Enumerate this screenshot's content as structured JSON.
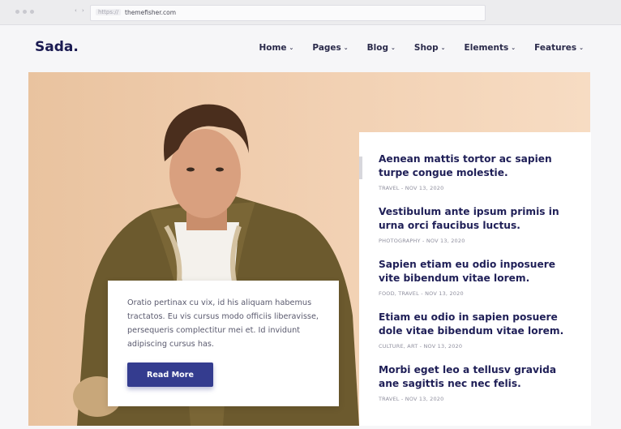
{
  "browser": {
    "scheme": "https://",
    "url": "themefisher.com",
    "nav_arrows": "‹ ›"
  },
  "header": {
    "logo": "Sada.",
    "menu": [
      {
        "label": "Home",
        "icon": "chevron-down-icon"
      },
      {
        "label": "Pages",
        "icon": "chevron-down-icon"
      },
      {
        "label": "Blog",
        "icon": "chevron-down-icon"
      },
      {
        "label": "Shop",
        "icon": "chevron-down-icon"
      },
      {
        "label": "Elements",
        "icon": "chevron-down-icon"
      },
      {
        "label": "Features",
        "icon": "chevron-down-icon"
      }
    ]
  },
  "hero": {
    "excerpt": "Oratio pertinax cu vix, id his aliquam habemus tractatos. Eu vis cursus modo officiis liberavisse, persequeris complectitur mei et. Id invidunt adipiscing cursus has.",
    "button_label": "Read More"
  },
  "posts": [
    {
      "title": "Aenean mattis tortor ac sapien turpe congue molestie.",
      "category": "TRAVEL",
      "separator": "-",
      "date": "NOV 13, 2020"
    },
    {
      "title": "Vestibulum ante ipsum primis in urna orci faucibus luctus.",
      "category": "PHOTOGRAPHY",
      "separator": "-",
      "date": "NOV 13, 2020"
    },
    {
      "title": "Sapien etiam eu odio inposuere vite bibendum vitae lorem.",
      "category": "FOOD, TRAVEL",
      "separator": "-",
      "date": "NOV 13, 2020"
    },
    {
      "title": "Etiam eu odio in sapien posuere dole vitae bibendum vitae lorem.",
      "category": "CULTURE, ART",
      "separator": "-",
      "date": "NOV 13, 2020"
    },
    {
      "title": "Morbi eget leo a tellusv gravida ane sagittis nec nec felis.",
      "category": "TRAVEL",
      "separator": "-",
      "date": "NOV 13, 2020"
    }
  ],
  "colors": {
    "accent": "#343c8f",
    "heading": "#1f1f57",
    "hero_bg": "#f0cdae"
  }
}
